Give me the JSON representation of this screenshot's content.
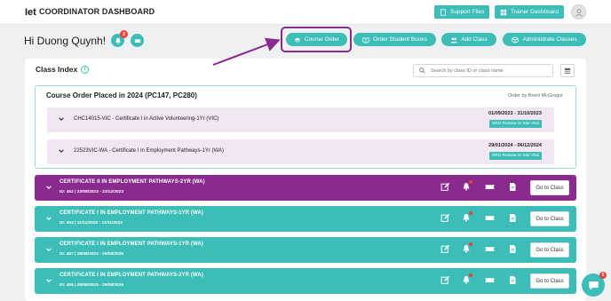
{
  "app": {
    "logo": "Iet",
    "title": "COORDINATOR DASHBOARD"
  },
  "topbar": {
    "support_files": "Support Files",
    "trainer_dashboard": "Trainer Dashboard"
  },
  "greeting": "Hi Duong Quynh!",
  "notifications_count": "2",
  "actions": {
    "course_order": "Course Order",
    "order_student_books": "Order Student Books",
    "add_class": "Add Class",
    "administrate_classes": "Administrate Classes"
  },
  "class_index": {
    "title": "Class Index",
    "search_placeholder": "Search by class ID or class name"
  },
  "order": {
    "title": "Course Order Placed in 2024 (PC147, PC280)",
    "ordered_by": "Order by Brent McGregor",
    "courses": [
      {
        "name": "CHC14015-VIC - Certificate I in Active Volunteering-1Yr (VIC)",
        "dates": "01/09/2023 - 31/10/2023",
        "tag": "SRO Review or Site Visit"
      },
      {
        "name": "22523VIC-WA - Certificate I in Employment Pathways-1Yr (WA)",
        "dates": "29/01/2024 - 06/12/2024",
        "tag": "SRO Review or Site Visit"
      }
    ]
  },
  "classes": [
    {
      "name": "CERTIFICATE II IN EMPLOYMENT PATHWAYS-2YR (WA)",
      "meta": "ID: 452 | 23/08/2023 - 23/12/2023",
      "color": "#8b2a8e",
      "goto": "Go to Class"
    },
    {
      "name": "CERTIFICATE I IN EMPLOYMENT PATHWAYS-1YR (WA)",
      "meta": "ID: 453 | 11/11/2020 - 11/11/2023",
      "color": "#3cbdb7",
      "goto": "Go to Class"
    },
    {
      "name": "CERTIFICATE I IN EMPLOYMENT PATHWAYS-1YR (WA)",
      "meta": "ID: 457 | 29/08/2023 - 29/08/2026",
      "color": "#3cbdb7",
      "goto": "Go to Class"
    },
    {
      "name": "CERTIFICATE I IN EMPLOYMENT PATHWAYS-2YR (WA)",
      "meta": "ID: 455 | 29/08/2023 - 29/08/2026",
      "color": "#3cbdb7",
      "goto": "Go to Class"
    }
  ],
  "chat_badge": "5",
  "colors": {
    "accent": "#3cbdb7",
    "highlight": "#8b2a8e",
    "course_row_bg": "#f3e6f3",
    "alert": "#e8413c"
  }
}
